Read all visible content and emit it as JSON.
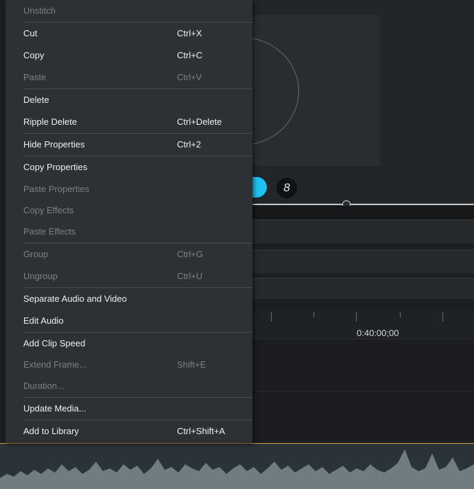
{
  "context_menu": {
    "items": [
      {
        "label": "Unstitch",
        "shortcut": "",
        "enabled": false
      },
      {
        "label": "Cut",
        "shortcut": "Ctrl+X",
        "enabled": true
      },
      {
        "label": "Copy",
        "shortcut": "Ctrl+C",
        "enabled": true
      },
      {
        "label": "Paste",
        "shortcut": "Ctrl+V",
        "enabled": false
      },
      {
        "label": "Delete",
        "shortcut": "",
        "enabled": true
      },
      {
        "label": "Ripple Delete",
        "shortcut": "Ctrl+Delete",
        "enabled": true
      },
      {
        "label": "Hide Properties",
        "shortcut": "Ctrl+2",
        "enabled": true
      },
      {
        "label": "Copy Properties",
        "shortcut": "",
        "enabled": true
      },
      {
        "label": "Paste Properties",
        "shortcut": "",
        "enabled": false
      },
      {
        "label": "Copy Effects",
        "shortcut": "",
        "enabled": false
      },
      {
        "label": "Paste Effects",
        "shortcut": "",
        "enabled": false
      },
      {
        "label": "Group",
        "shortcut": "Ctrl+G",
        "enabled": false
      },
      {
        "label": "Ungroup",
        "shortcut": "Ctrl+U",
        "enabled": false
      },
      {
        "label": "Separate Audio and Video",
        "shortcut": "",
        "enabled": true
      },
      {
        "label": "Edit Audio",
        "shortcut": "",
        "enabled": true
      },
      {
        "label": "Add Clip Speed",
        "shortcut": "",
        "enabled": true
      },
      {
        "label": "Extend Frame...",
        "shortcut": "Shift+E",
        "enabled": false
      },
      {
        "label": "Duration...",
        "shortcut": "",
        "enabled": false
      },
      {
        "label": "Update Media...",
        "shortcut": "",
        "enabled": true
      },
      {
        "label": "Add to Library",
        "shortcut": "Ctrl+Shift+A",
        "enabled": true
      }
    ]
  },
  "timeline": {
    "ruler_label": "0:40:00;00"
  },
  "toolbar": {
    "annotation_icon": "annotation-icon",
    "camera_icon": "camera-icon"
  },
  "colors": {
    "accent_cyan": "#1ec2f0",
    "audio_border": "#d9a23a"
  }
}
